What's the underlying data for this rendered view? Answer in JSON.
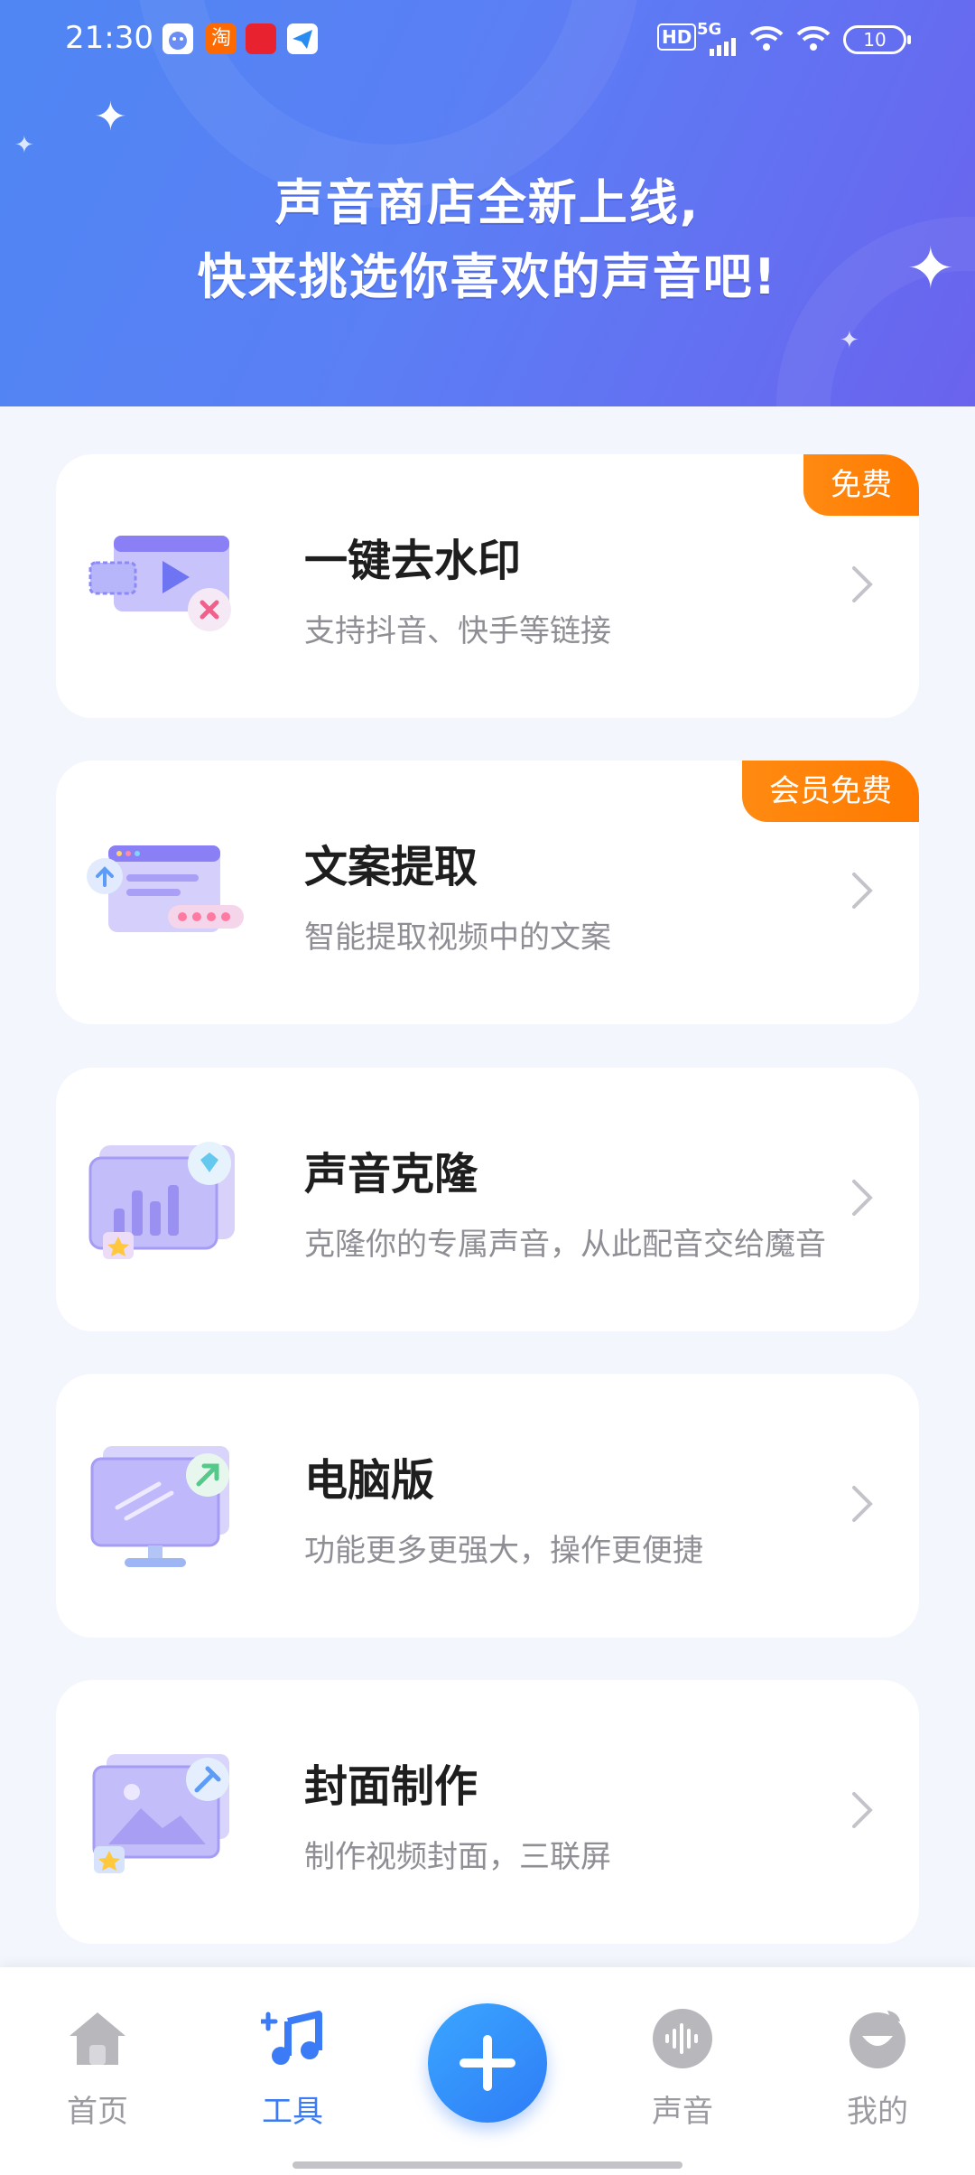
{
  "status_bar": {
    "time": "21:30",
    "network": "5G",
    "hd": "HD",
    "battery": "10",
    "app_icons": [
      "android-notif-icon",
      "taobao-icon",
      "douyin-notif-icon",
      "message-send-icon"
    ]
  },
  "banner": {
    "line1": "声音商店全新上线,",
    "line2": "快来挑选你喜欢的声音吧!"
  },
  "cards": [
    {
      "title": "一键去水印",
      "subtitle": "支持抖音、快手等链接",
      "tag": "免费",
      "icon": "video-remove-watermark-icon"
    },
    {
      "title": "文案提取",
      "subtitle": "智能提取视频中的文案",
      "tag": "会员免费",
      "icon": "text-extract-icon"
    },
    {
      "title": "声音克隆",
      "subtitle": "克隆你的专属声音，从此配音交给魔音",
      "tag": "",
      "icon": "voice-clone-icon"
    },
    {
      "title": "电脑版",
      "subtitle": "功能更多更强大，操作更便捷",
      "tag": "",
      "icon": "desktop-version-icon"
    },
    {
      "title": "封面制作",
      "subtitle": "制作视频封面，三联屏",
      "tag": "",
      "icon": "cover-maker-icon"
    }
  ],
  "nav": {
    "items": [
      {
        "label": "首页",
        "icon": "home-icon",
        "active": false
      },
      {
        "label": "工具",
        "icon": "music-tools-icon",
        "active": true
      },
      {
        "label": "",
        "icon": "plus-icon",
        "active": false
      },
      {
        "label": "声音",
        "icon": "voice-wave-icon",
        "active": false
      },
      {
        "label": "我的",
        "icon": "profile-icon",
        "active": false
      }
    ]
  },
  "colors": {
    "accent": "#3b7bf6",
    "tag_orange": "#ff8000",
    "banner_start": "#4f86f4",
    "banner_end": "#6a63ee"
  }
}
